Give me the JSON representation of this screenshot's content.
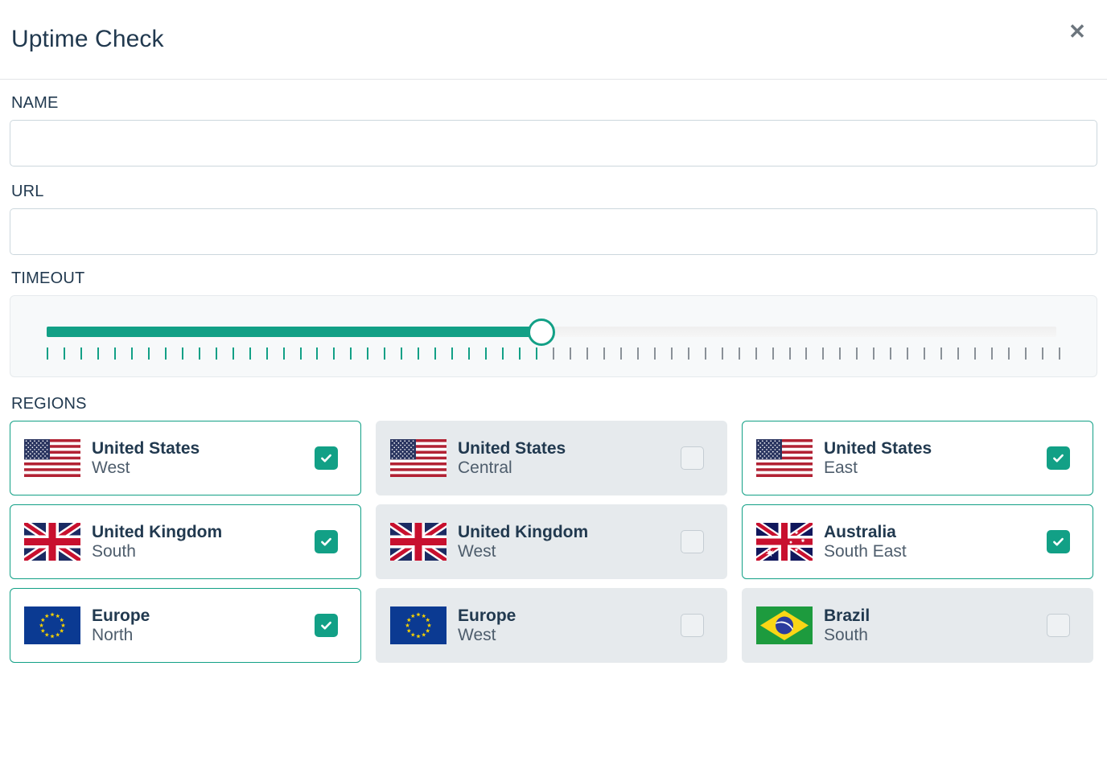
{
  "header": {
    "title": "Uptime Check",
    "close_label": "✕",
    "close_icon": "close-icon"
  },
  "form": {
    "name": {
      "label": "NAME",
      "value": "",
      "placeholder": ""
    },
    "url": {
      "label": "URL",
      "value": "",
      "placeholder": ""
    },
    "timeout": {
      "label": "TIMEOUT",
      "fill_percent": 49,
      "tick_count": 61,
      "ticks_on": 30,
      "accent_color": "#12a086"
    },
    "regions": {
      "label": "REGIONS",
      "items": [
        {
          "country": "United States",
          "sub": "West",
          "flag": "us-flag-icon",
          "selected": true
        },
        {
          "country": "United States",
          "sub": "Central",
          "flag": "us-flag-icon",
          "selected": false
        },
        {
          "country": "United States",
          "sub": "East",
          "flag": "us-flag-icon",
          "selected": true
        },
        {
          "country": "United Kingdom",
          "sub": "South",
          "flag": "uk-flag-icon",
          "selected": true
        },
        {
          "country": "United Kingdom",
          "sub": "West",
          "flag": "uk-flag-icon",
          "selected": false
        },
        {
          "country": "Australia",
          "sub": "South East",
          "flag": "au-flag-icon",
          "selected": true
        },
        {
          "country": "Europe",
          "sub": "North",
          "flag": "eu-flag-icon",
          "selected": true
        },
        {
          "country": "Europe",
          "sub": "West",
          "flag": "eu-flag-icon",
          "selected": false
        },
        {
          "country": "Brazil",
          "sub": "South",
          "flag": "br-flag-icon",
          "selected": false
        }
      ]
    }
  },
  "colors": {
    "accent": "#12a086",
    "title": "#21394f",
    "card_unselected_bg": "#e6eaed",
    "panel_bg": "#f7f9fa"
  }
}
